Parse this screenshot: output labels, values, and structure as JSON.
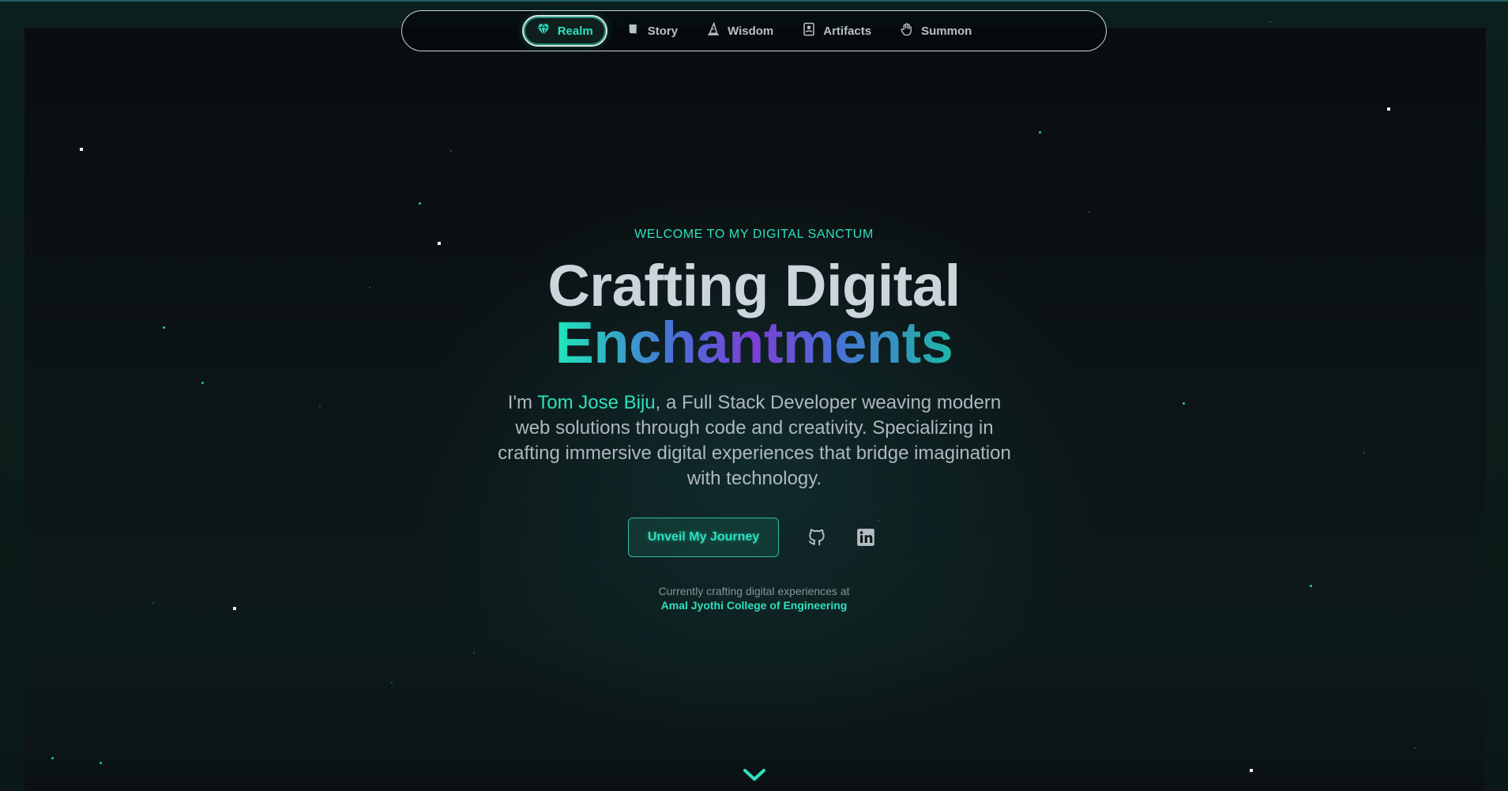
{
  "nav": {
    "items": [
      {
        "label": "Realm",
        "icon": "gem-icon",
        "active": true
      },
      {
        "label": "Story",
        "icon": "scroll-icon",
        "active": false
      },
      {
        "label": "Wisdom",
        "icon": "wizard-hat-icon",
        "active": false
      },
      {
        "label": "Artifacts",
        "icon": "book-icon",
        "active": false
      },
      {
        "label": "Summon",
        "icon": "hand-icon",
        "active": false
      }
    ]
  },
  "hero": {
    "eyebrow": "WELCOME TO MY DIGITAL SANCTUM",
    "title_line1": "Crafting Digital",
    "title_line2": "Enchantments",
    "intro_prefix": "I'm ",
    "intro_name": "Tom Jose Biju",
    "intro_suffix": ", a Full Stack Developer weaving modern web solutions through code and creativity. Specializing in crafting immersive digital experiences that bridge imagination with technology.",
    "cta_label": "Unveil My Journey",
    "current_text": "Currently crafting digital experiences at",
    "organization": "Amal Jyothi College of Engineering"
  },
  "social": [
    {
      "icon": "github-icon"
    },
    {
      "icon": "linkedin-icon"
    }
  ],
  "colors": {
    "accent": "#2fe0bd",
    "background": "#0a0d0f",
    "title": "#ccd5db",
    "body_text": "#aeb8be"
  }
}
